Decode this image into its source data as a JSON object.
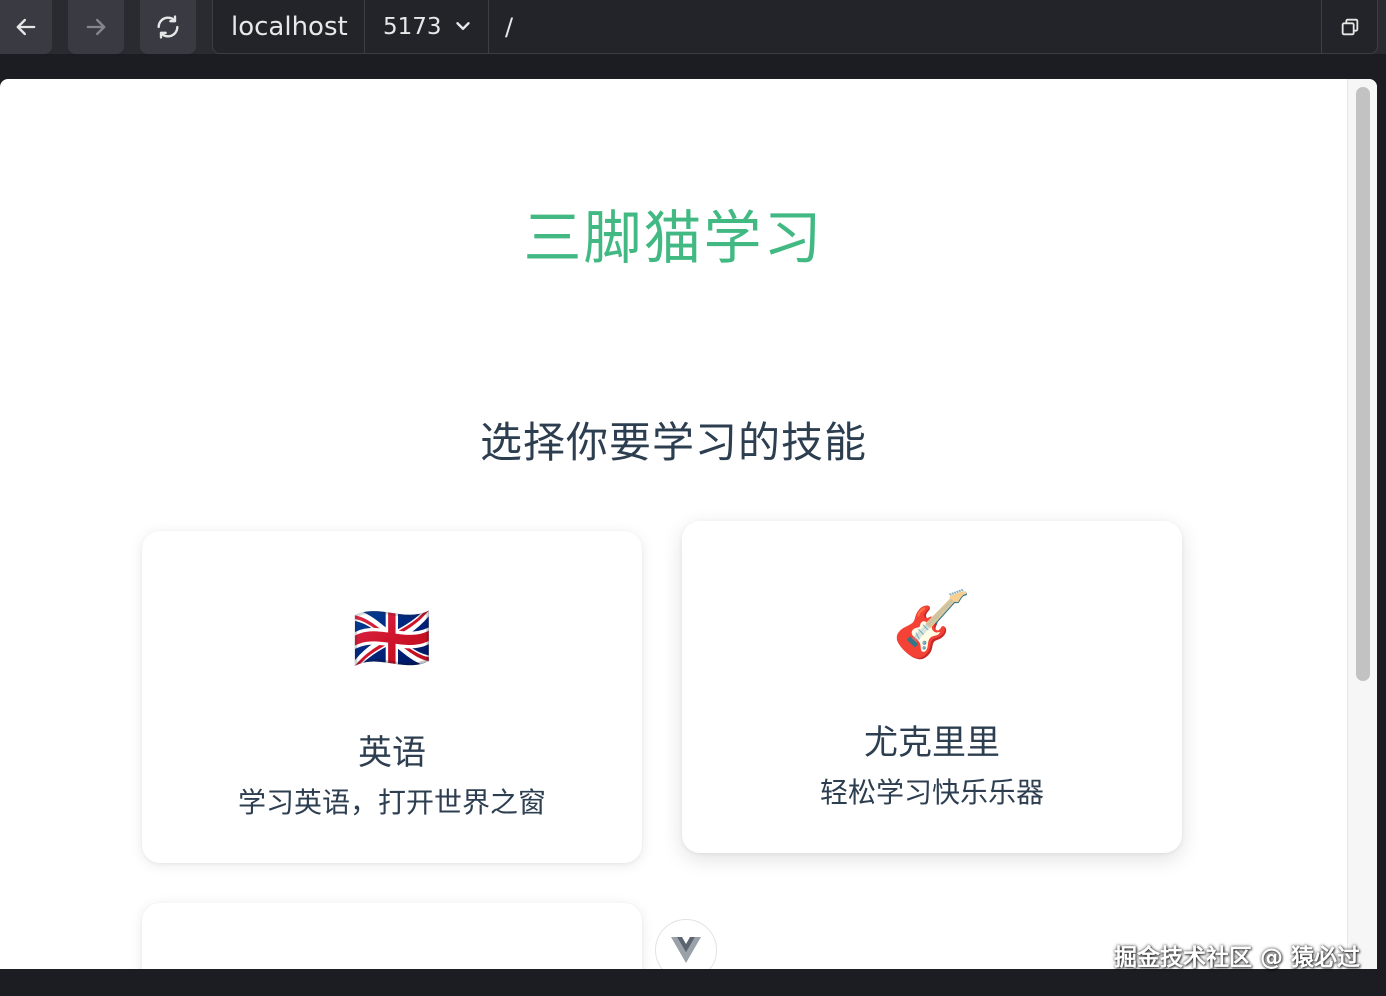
{
  "browser": {
    "host": "localhost",
    "port": "5173",
    "path": "/"
  },
  "page": {
    "brand": "三脚猫学习",
    "subtitle": "选择你要学习的技能",
    "skills": [
      {
        "icon": "🇬🇧",
        "icon_name": "uk-flag-icon",
        "title": "英语",
        "desc": "学习英语，打开世界之窗"
      },
      {
        "icon": "🎸",
        "icon_name": "guitar-icon",
        "title": "尤克里里",
        "desc": "轻松学习快乐乐器"
      }
    ]
  },
  "watermark": "掘金技术社区 @ 猿必过",
  "colors": {
    "brand": "#42b983",
    "text": "#2c3e50"
  }
}
